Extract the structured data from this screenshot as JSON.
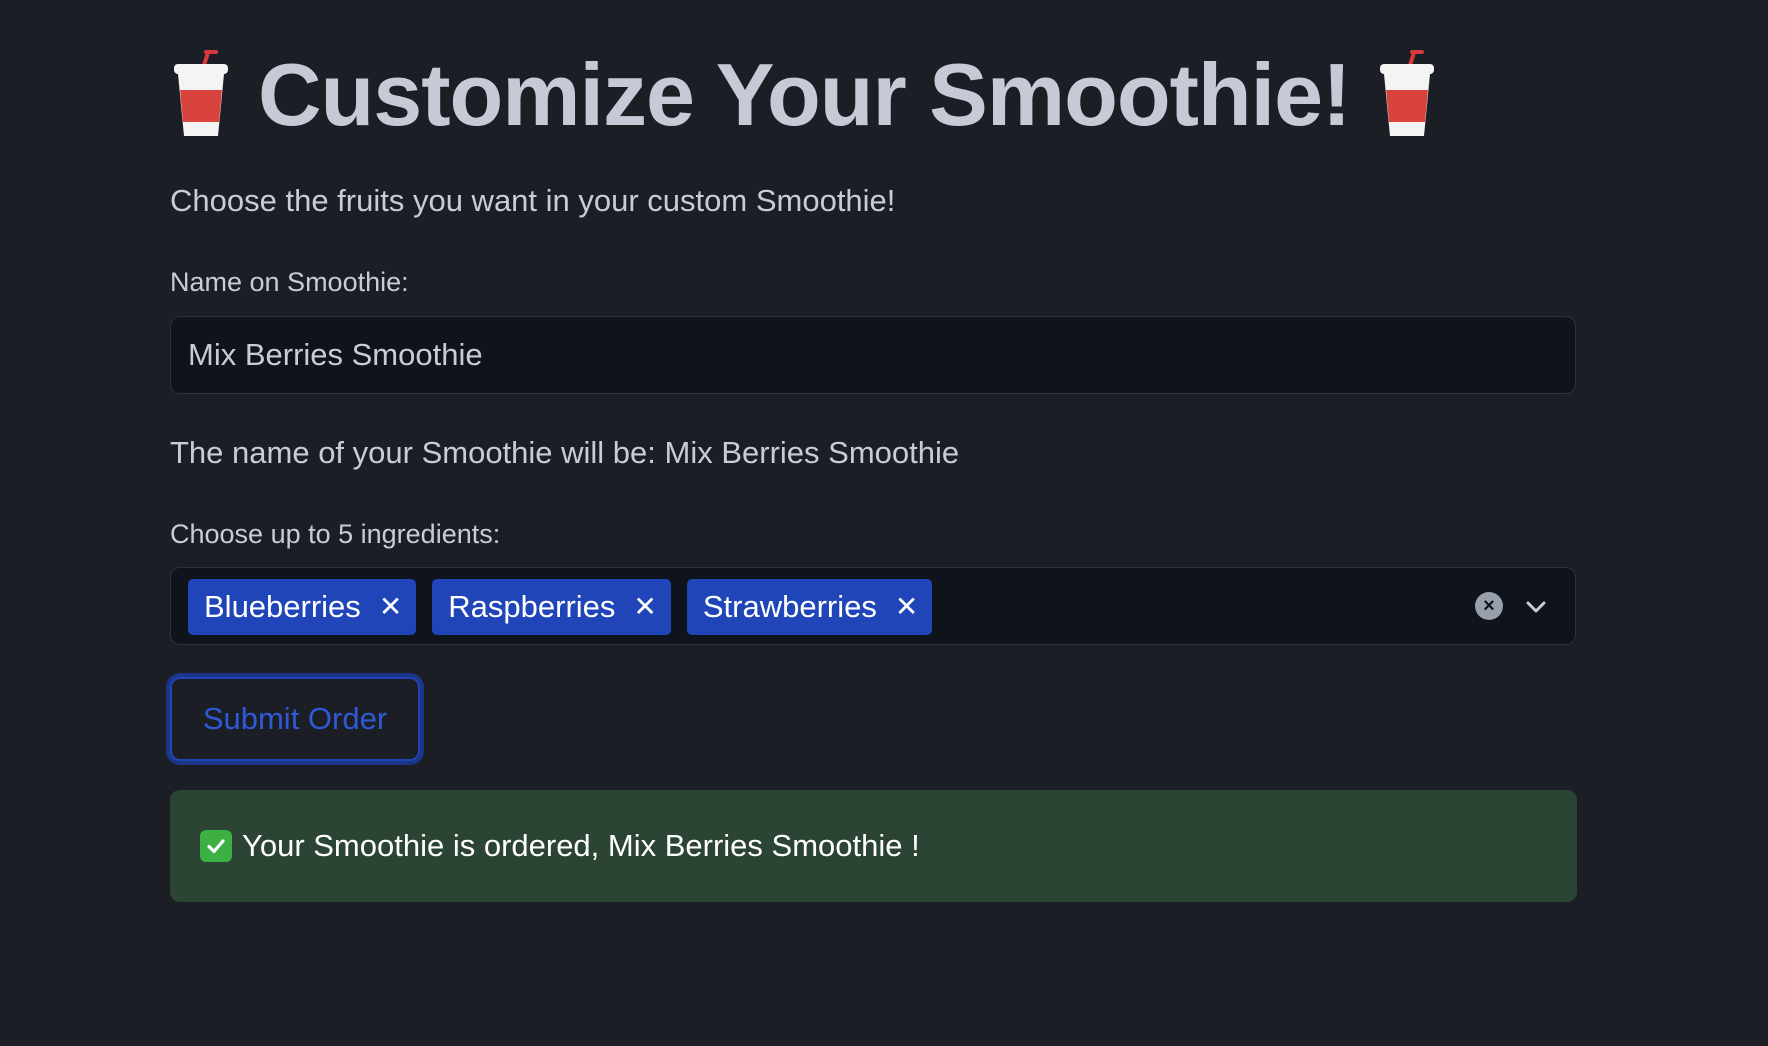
{
  "header": {
    "title": "Customize Your Smoothie!",
    "left_icon": "cup-with-straw-icon",
    "right_icon": "cup-with-straw-icon"
  },
  "intro": {
    "subtitle": "Choose the fruits you want in your custom Smoothie!"
  },
  "name_field": {
    "label": "Name on Smoothie:",
    "value": "Mix Berries Smoothie"
  },
  "name_preview": {
    "text": "The name of your Smoothie will be: Mix Berries Smoothie"
  },
  "ingredients": {
    "label": "Choose up to 5 ingredients:",
    "selected": [
      {
        "label": "Blueberries",
        "remove_icon": "close-icon"
      },
      {
        "label": "Raspberries",
        "remove_icon": "close-icon"
      },
      {
        "label": "Strawberries",
        "remove_icon": "close-icon"
      }
    ],
    "clear_icon": "clear-all-icon",
    "dropdown_icon": "chevron-down-icon"
  },
  "actions": {
    "submit_label": "Submit Order"
  },
  "success": {
    "icon": "check-mark-icon",
    "message": "Your Smoothie is ordered, Mix Berries Smoothie !"
  },
  "colors": {
    "background": "#1b1e24",
    "accent": "#1f45b8",
    "success_bg": "#2c4434"
  }
}
